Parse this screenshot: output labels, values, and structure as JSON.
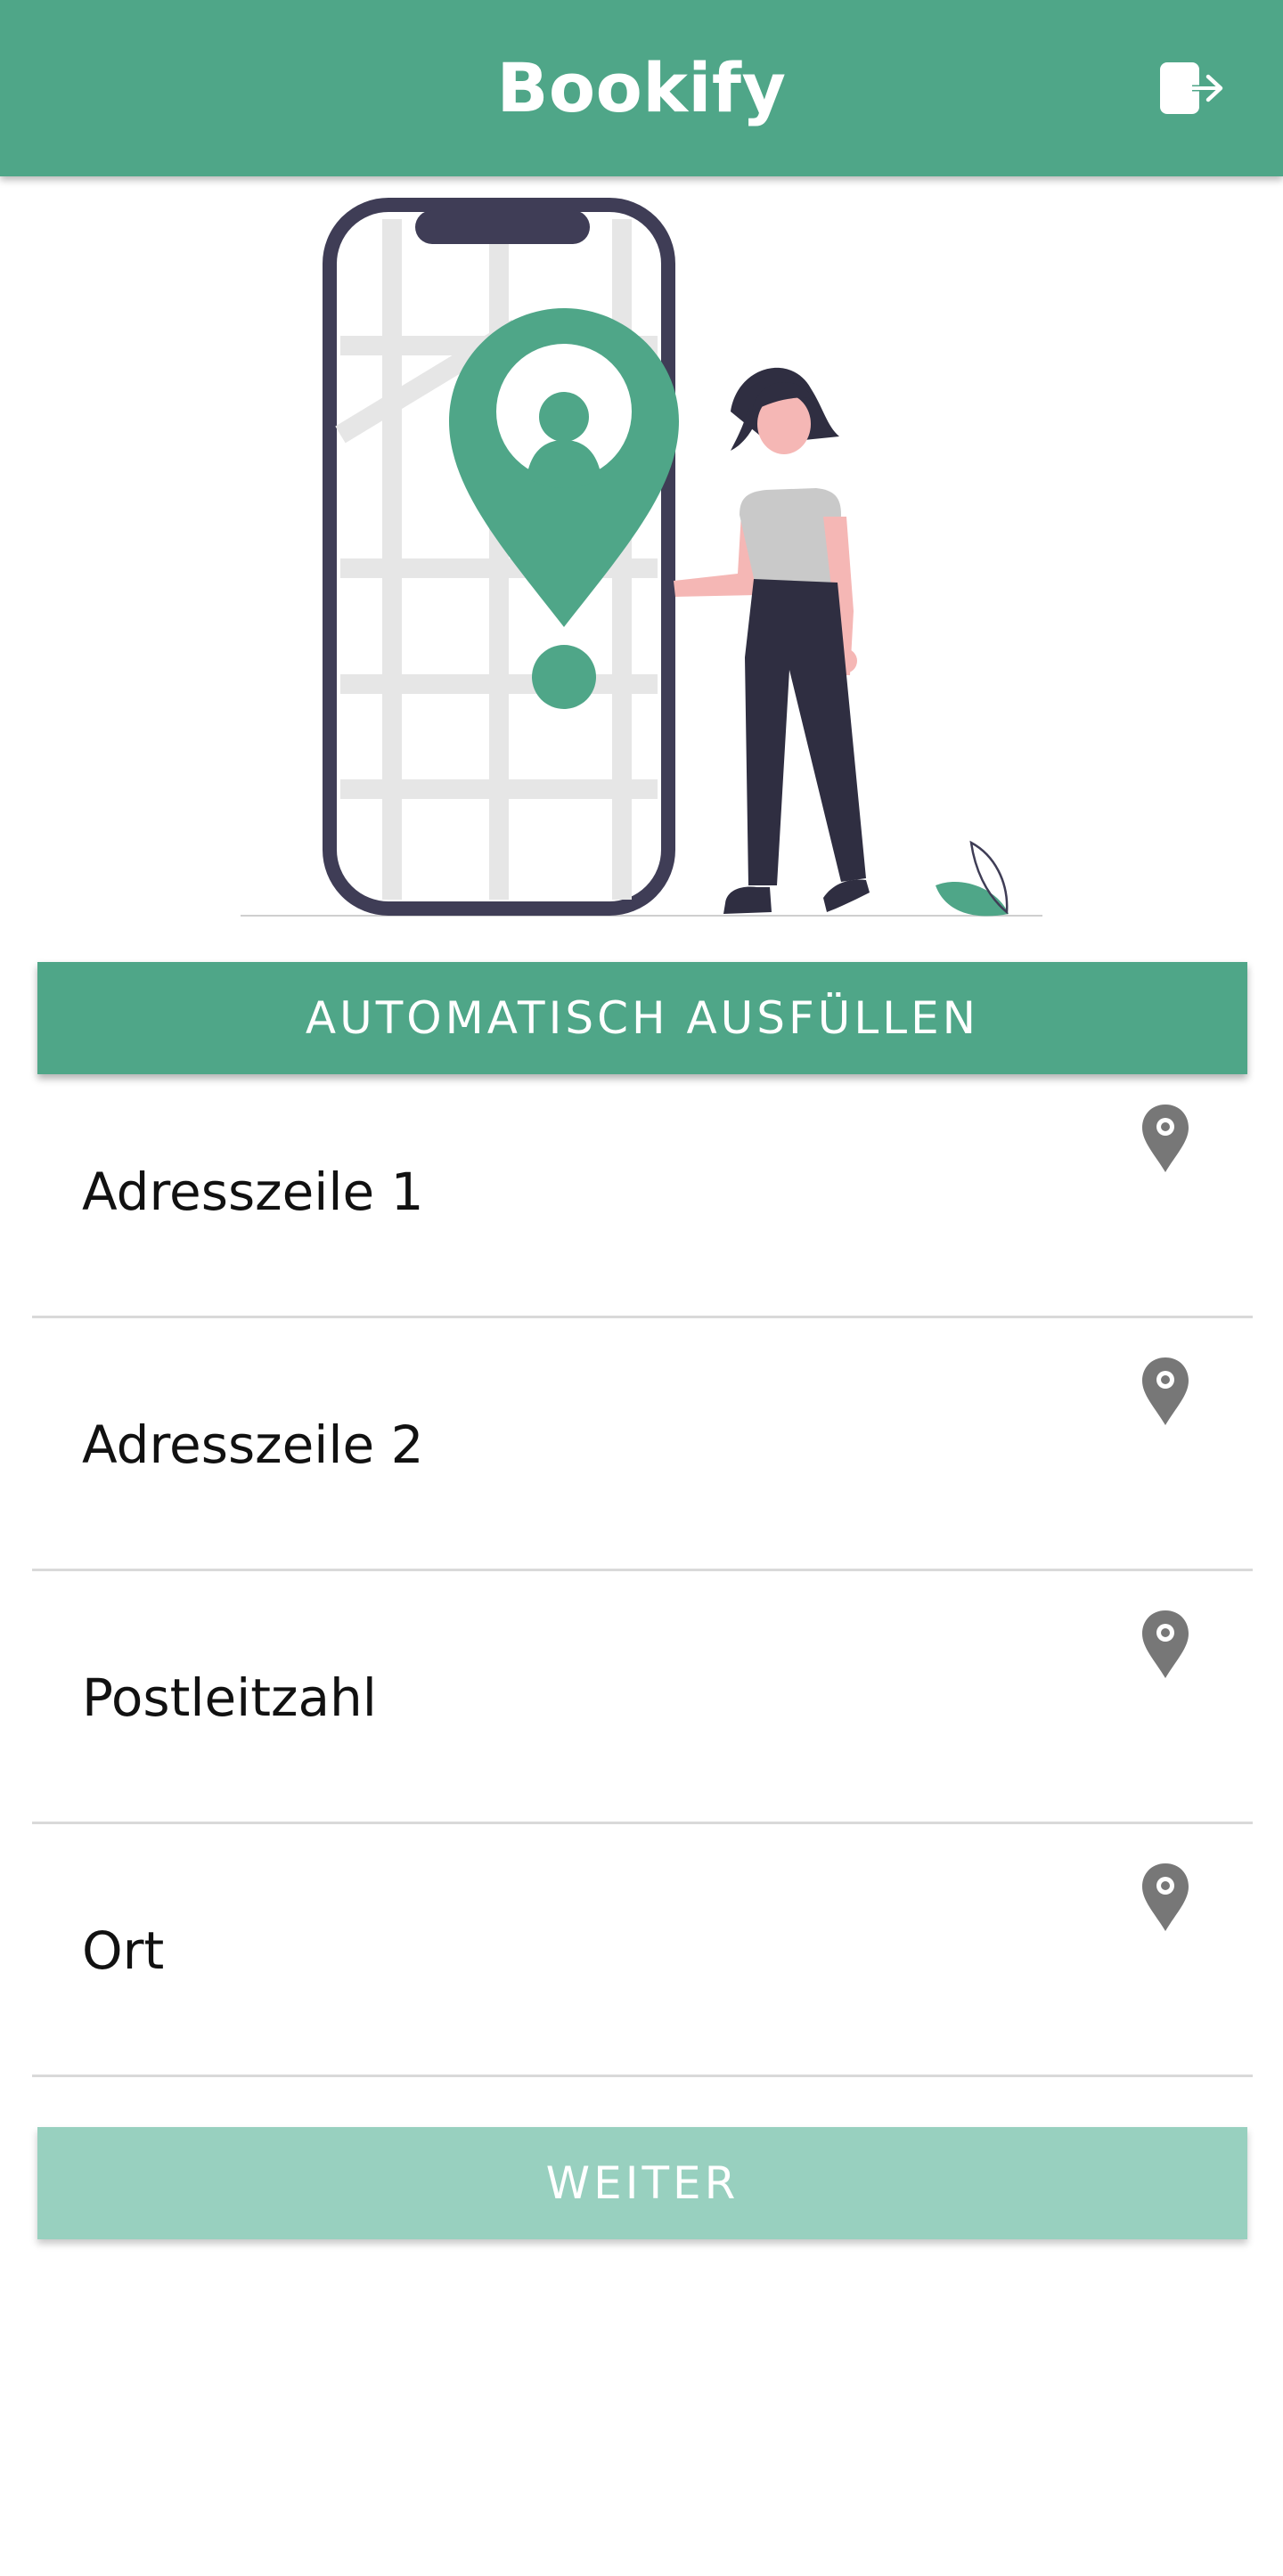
{
  "app": {
    "title": "Bookify",
    "logout_icon": "logout-icon",
    "colors": {
      "primary": "#4fa688",
      "primary_disabled": "#98d0bf",
      "icon_gray": "#777777"
    }
  },
  "autofill_button": {
    "label": "AUTOMATISCH AUSFÜLLEN"
  },
  "fields": [
    {
      "label": "Adresszeile 1",
      "value": "",
      "icon": "location-pin-icon"
    },
    {
      "label": "Adresszeile 2",
      "value": "",
      "icon": "location-pin-icon"
    },
    {
      "label": "Postleitzahl",
      "value": "",
      "icon": "location-pin-icon"
    },
    {
      "label": "Ort",
      "value": "",
      "icon": "location-pin-icon"
    }
  ],
  "next_button": {
    "label": "WEITER",
    "disabled": true
  }
}
